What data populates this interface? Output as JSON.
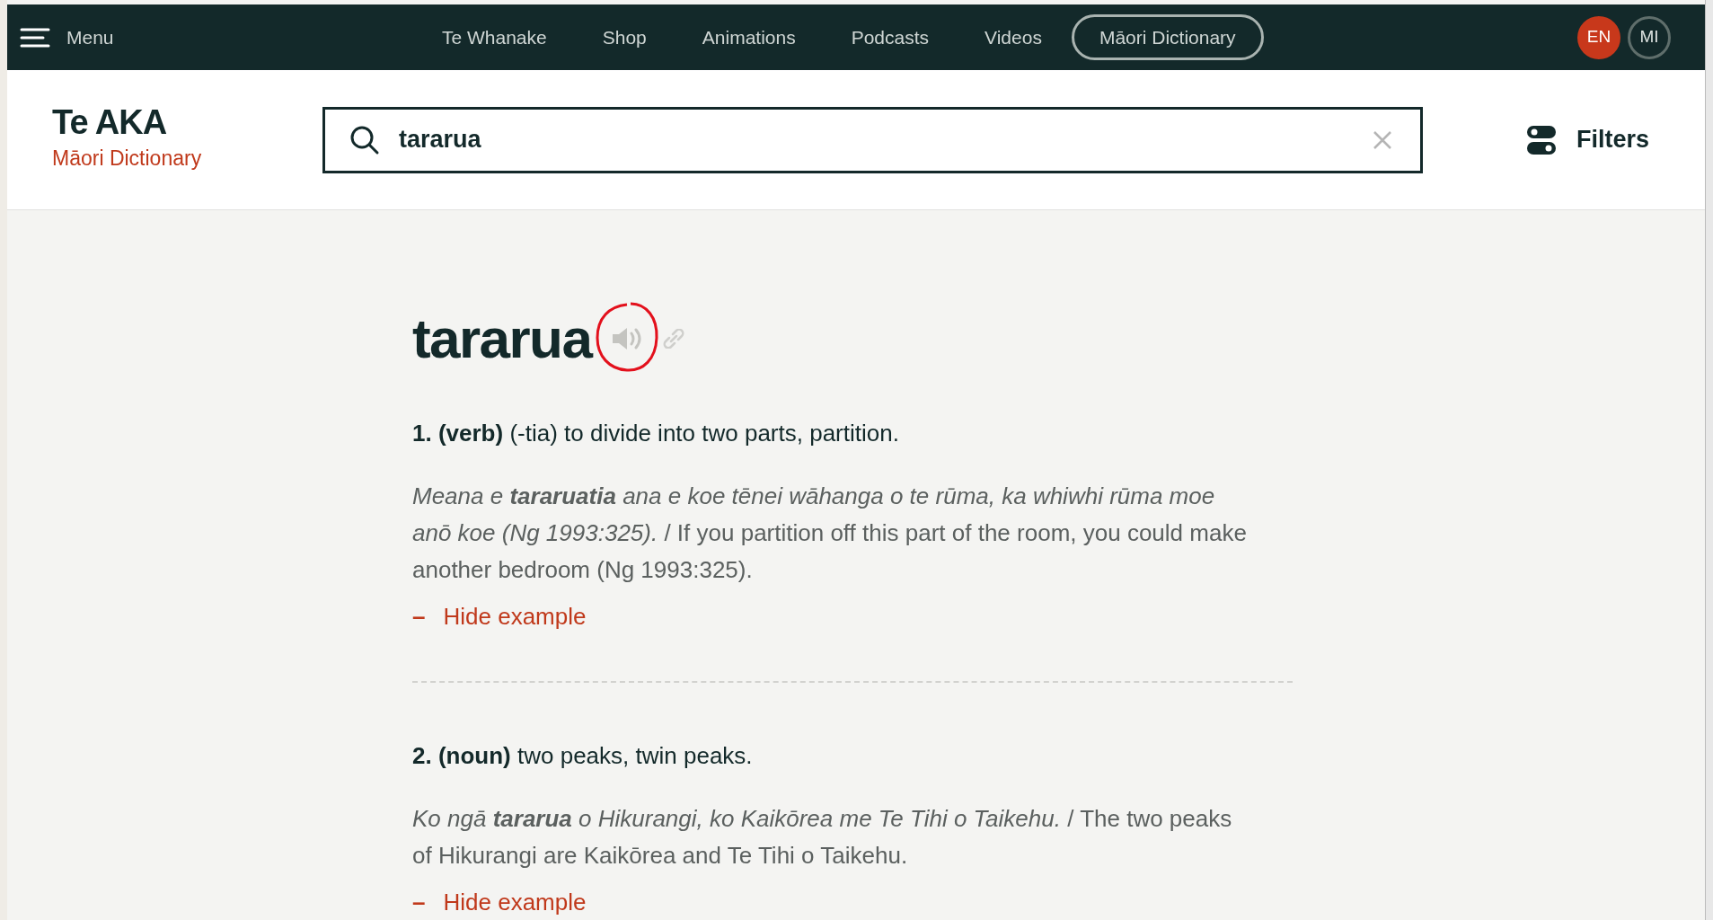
{
  "topbar": {
    "menu_label": "Menu",
    "nav": [
      {
        "label": "Te Whanake",
        "selected": false
      },
      {
        "label": "Shop",
        "selected": false
      },
      {
        "label": "Animations",
        "selected": false
      },
      {
        "label": "Podcasts",
        "selected": false
      },
      {
        "label": "Videos",
        "selected": false
      },
      {
        "label": "Māori Dictionary",
        "selected": true
      }
    ],
    "languages": [
      {
        "label": "EN",
        "selected": true
      },
      {
        "label": "MI",
        "selected": false
      }
    ]
  },
  "header": {
    "logo_title": "Te AKA",
    "logo_subtitle": "Māori Dictionary",
    "search": {
      "value": "tararua"
    },
    "filters_label": "Filters"
  },
  "entry": {
    "headword": "tararua",
    "senses": [
      {
        "definition": "**1. (verb)** (-tia) to divide into two parts, partition.",
        "example_mi": "Meana e **tararuatia** ana e koe tēnei wāhanga o te rūma, ka whiwhi rūma moe anō koe (Ng 1993:325).",
        "example_en": "/ If you partition off this part of the room, you could make another bedroom (Ng 1993:325).",
        "toggle_sign": "–",
        "toggle_label": "Hide example"
      },
      {
        "definition": "**2. (noun)** two peaks, twin peaks.",
        "example_mi": "Ko ngā **tararua** o Hikurangi, ko Kaikōrea me Te Tihi o Taikehu.",
        "example_en": "/ The two peaks of Hikurangi are Kaikōrea and Te Tihi o Taikehu.",
        "toggle_sign": "–",
        "toggle_label": "Hide example"
      }
    ]
  }
}
